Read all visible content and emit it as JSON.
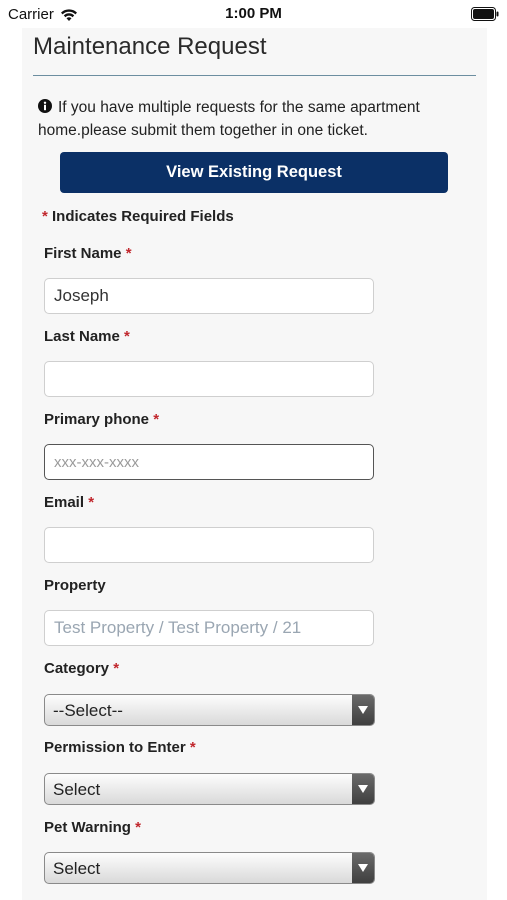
{
  "status_bar": {
    "carrier": "Carrier",
    "time": "1:00 PM"
  },
  "page": {
    "title": "Maintenance Request",
    "info_note": "If you have multiple requests for the same apartment home.please submit them together in one ticket.",
    "view_button_label": "View Existing Request",
    "required_note": "Indicates Required Fields",
    "required_marker": "*"
  },
  "form": {
    "first_name": {
      "label": "First Name",
      "value": "Joseph",
      "required": true
    },
    "last_name": {
      "label": "Last Name",
      "value": "",
      "required": true
    },
    "primary_phone": {
      "label": "Primary phone",
      "value": "",
      "placeholder": "xxx-xxx-xxxx",
      "required": true
    },
    "email": {
      "label": "Email",
      "value": "",
      "required": true
    },
    "property": {
      "label": "Property",
      "value": "Test Property / Test Property / 21",
      "required": false
    },
    "category": {
      "label": "Category",
      "selected": "--Select--",
      "required": true
    },
    "permission_to_enter": {
      "label": "Permission to Enter",
      "selected": "Select",
      "required": true
    },
    "pet_warning": {
      "label": "Pet Warning",
      "selected": "Select",
      "required": true
    }
  },
  "icons": {
    "wifi": "wifi-icon",
    "battery": "battery-icon",
    "info": "info-circle-icon",
    "dropdown": "triangle-down-icon"
  },
  "colors": {
    "primary_button": "#0b3066",
    "required_star": "#c1272d",
    "title_rule": "#6c8ea0"
  }
}
